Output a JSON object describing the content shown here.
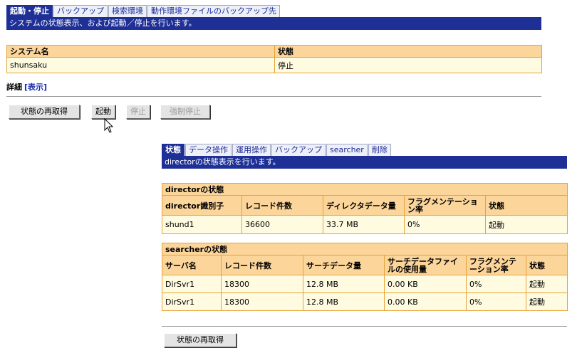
{
  "top_tabs": [
    "起動・停止",
    "バックアップ",
    "検索環境",
    "動作環境ファイルのバックアップ先"
  ],
  "top_banner": "システムの状態表示、および起動／停止を行います。",
  "system_table": {
    "headers": [
      "システム名",
      "状態"
    ],
    "row": [
      "shunsaku",
      "停止"
    ]
  },
  "detail": {
    "label": "詳細",
    "link": "[表示]"
  },
  "buttons": {
    "refresh": "状態の再取得",
    "start": "起動",
    "stop": "停止",
    "force_stop": "強制停止",
    "refresh_bottom": "状態の再取得"
  },
  "sub_tabs": [
    "状態",
    "データ操作",
    "運用操作",
    "バックアップ",
    "searcher",
    "削除"
  ],
  "sub_banner": "directorの状態表示を行います。",
  "director_table": {
    "caption": "directorの状態",
    "headers": [
      "director識別子",
      "レコード件数",
      "ディレクタデータ量",
      "フラグメンテーション率",
      "状態"
    ],
    "rows": [
      [
        "shund1",
        "36600",
        "33.7 MB",
        "0%",
        "起動"
      ]
    ]
  },
  "searcher_table": {
    "caption": "searcherの状態",
    "headers": [
      "サーバ名",
      "レコード件数",
      "サーチデータ量",
      "サーチデータファイルの使用量",
      "フラグメンテーション率",
      "状態"
    ],
    "rows": [
      [
        "DirSvr1",
        "18300",
        "12.8 MB",
        "0.00 KB",
        "0%",
        "起動"
      ],
      [
        "DirSvr1",
        "18300",
        "12.8 MB",
        "0.00 KB",
        "0%",
        "起動"
      ]
    ]
  },
  "colors": {
    "nav_blue": "#1e2f96",
    "header_orange": "#fcd59a",
    "border_orange": "#e6a23a",
    "cell_cream": "#fffbe1"
  }
}
